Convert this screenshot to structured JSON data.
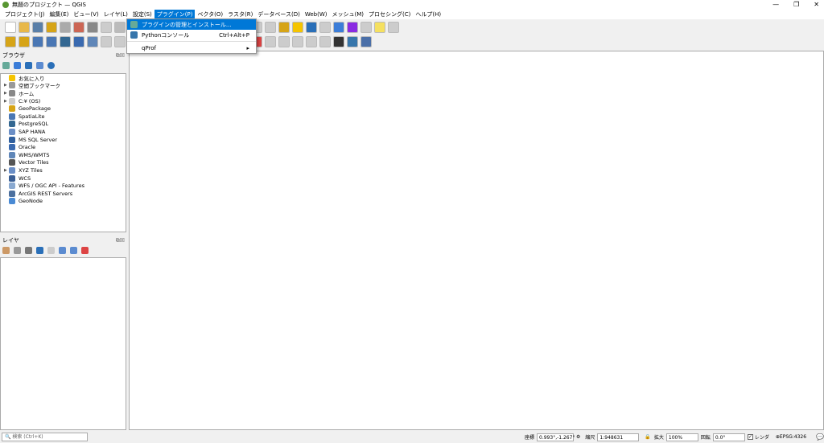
{
  "window": {
    "title": "無題のプロジェクト — QGIS"
  },
  "menubar": [
    "プロジェクト(J)",
    "編集(E)",
    "ビュー(V)",
    "レイヤ(L)",
    "設定(S)",
    "プラグイン(P)",
    "ベクタ(O)",
    "ラスタ(R)",
    "データベース(D)",
    "Web(W)",
    "メッシュ(M)",
    "プロセシング(C)",
    "ヘルプ(H)"
  ],
  "plugin_menu": [
    {
      "label": "プラグインの管理とインストール...",
      "shortcut": "",
      "highlighted": true
    },
    {
      "label": "Pythonコンソール",
      "shortcut": "Ctrl+Alt+P"
    },
    {
      "label": "qProf",
      "shortcut": "▸"
    }
  ],
  "browser": {
    "title": "ブラウザ",
    "items": [
      {
        "label": "お気に入り",
        "expand": false,
        "color": "#f5c400"
      },
      {
        "label": "空間ブックマーク",
        "expand": true,
        "color": "#999"
      },
      {
        "label": "ホーム",
        "expand": true,
        "color": "#888"
      },
      {
        "label": "C:¥ (OS)",
        "expand": true,
        "color": "#ccc"
      },
      {
        "label": "GeoPackage",
        "expand": false,
        "color": "#d6a417"
      },
      {
        "label": "SpatiaLite",
        "expand": false,
        "color": "#4a77b4"
      },
      {
        "label": "PostgreSQL",
        "expand": false,
        "color": "#336791"
      },
      {
        "label": "SAP HANA",
        "expand": false,
        "color": "#6a8ec6"
      },
      {
        "label": "MS SQL Server",
        "expand": false,
        "color": "#2f5f9e"
      },
      {
        "label": "Oracle",
        "expand": false,
        "color": "#3a6ab0"
      },
      {
        "label": "WMS/WMTS",
        "expand": false,
        "color": "#5f86b8"
      },
      {
        "label": "Vector Tiles",
        "expand": false,
        "color": "#555"
      },
      {
        "label": "XYZ Tiles",
        "expand": true,
        "color": "#6a8ec6"
      },
      {
        "label": "WCS",
        "expand": false,
        "color": "#3b5f95"
      },
      {
        "label": "WFS / OGC API - Features",
        "expand": false,
        "color": "#8aa9d0"
      },
      {
        "label": "ArcGIS REST Servers",
        "expand": false,
        "color": "#4b6f9e"
      },
      {
        "label": "GeoNode",
        "expand": false,
        "color": "#4a8ad4"
      }
    ]
  },
  "layers": {
    "title": "レイヤ"
  },
  "statusbar": {
    "search_placeholder": "検索 (Ctrl+K)",
    "coord_label": "座標",
    "coord_value": "0.993°,-1.267°",
    "scale_label": "縮尺",
    "scale_value": "1:948631",
    "magnify_label": "拡大",
    "magnify_value": "100%",
    "rotation_label": "回転",
    "rotation_value": "0.0°",
    "render_label": "レンダ",
    "crs": "EPSG:4326"
  }
}
